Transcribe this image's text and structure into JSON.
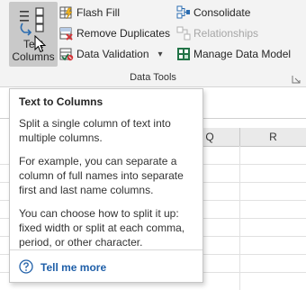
{
  "ribbon": {
    "text_to_columns": {
      "line1": "Text",
      "line2": "Columns"
    },
    "commands": {
      "flash_fill": "Flash Fill",
      "remove_duplicates": "Remove Duplicates",
      "data_validation": "Data Validation",
      "consolidate": "Consolidate",
      "relationships": "Relationships",
      "manage_data_model": "Manage Data Model"
    },
    "group_label": "Data Tools"
  },
  "grid": {
    "columns": [
      "Q",
      "R"
    ]
  },
  "tooltip": {
    "title": "Text to Columns",
    "paragraphs": [
      "Split a single column of text into multiple columns.",
      "For example, you can separate a column of full names into separate first and last name columns.",
      "You can choose how to split it up: fixed width or split at each comma, period, or other character."
    ],
    "link": "Tell me more"
  },
  "colors": {
    "ribbon_bg": "#f3f3f3",
    "hover_bg": "#c9c9c9",
    "link": "#1f5fa8",
    "disabled_text": "#a6a6a6",
    "excel_green": "#217346"
  },
  "icons": {
    "text_to_columns": "text-to-columns-icon",
    "flash_fill": "flash-fill-icon",
    "remove_duplicates": "remove-duplicates-icon",
    "data_validation": "data-validation-icon",
    "consolidate": "consolidate-icon",
    "relationships": "relationships-icon",
    "manage_data_model": "data-model-icon",
    "help": "help-circle-icon",
    "cursor": "mouse-pointer-icon"
  }
}
